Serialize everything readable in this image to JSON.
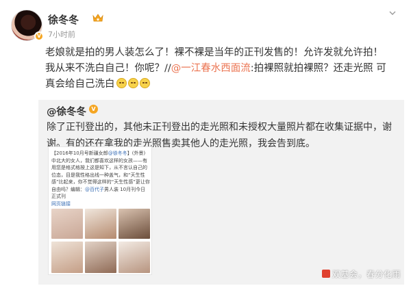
{
  "post": {
    "username": "徐冬冬",
    "time": "7小时前",
    "text_part1": "老娘就是拍的男人装怎么了！裸不裸是当年的正刊发售的！允许发就允许拍！我从来不洗白自己！你呢？//",
    "mention": "@一江春水西面流",
    "text_part2": ":拍裸照就拍裸照？还走光照 可真会给自己洗白",
    "emojis": [
      "face-emoji",
      "face-emoji",
      "face-emoji"
    ],
    "colors": {
      "mention": "#eb7350",
      "vip": "#f5a623",
      "repost_bg": "#f2f2f2"
    }
  },
  "repost": {
    "username": "@徐冬冬",
    "text": "除了正刊登出的，其他未正刊登出的走光照和未授权大量照片都在收集证据中，谢谢。有的还在拿我的走光照售卖其他人的走光照，我会告到底。"
  },
  "clipping": {
    "header": "【2016年10月号新疆女郎",
    "header_mention": "@徐冬冬",
    "header_tail": "】(外景)",
    "body": "中北大的女人，我们都喜欢这样的女孩——有用您是格式格按上这是知下，从不言认自己的位态，目是我性格出线一种盖气，和“天生性感”比起来，你不觉得这样的“天生性感”更让你自由吗？编辑：",
    "body_mention": "@百代子",
    "body_tail": "男人装 10月刊今日正式刊",
    "link": "网页链接"
  },
  "watermark": "双基会，春分化雨"
}
